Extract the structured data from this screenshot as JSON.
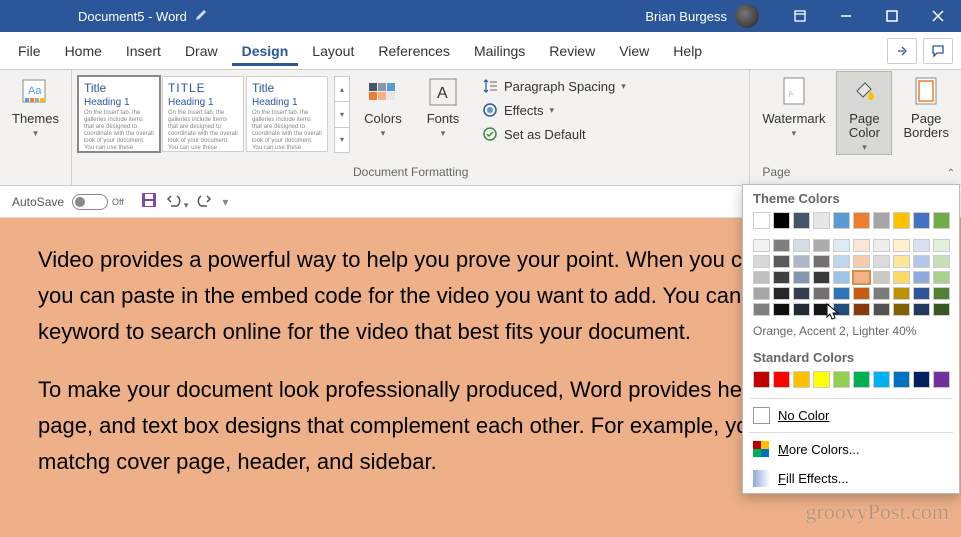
{
  "titlebar": {
    "title": "Document5  -  Word",
    "user": "Brian Burgess"
  },
  "tabs": [
    "File",
    "Home",
    "Insert",
    "Draw",
    "Design",
    "Layout",
    "References",
    "Mailings",
    "Review",
    "View",
    "Help"
  ],
  "active_tab_index": 4,
  "ribbon": {
    "themes_label": "Themes",
    "doc_formatting_label": "Document Formatting",
    "page_bg_label": "Page Background",
    "colors_label": "Colors",
    "fonts_label": "Fonts",
    "para_spacing": "Paragraph Spacing",
    "effects": "Effects",
    "set_default": "Set as Default",
    "watermark_label": "Watermark",
    "page_color_label": "Page\nColor",
    "page_borders_label": "Page\nBorders",
    "gallery": [
      {
        "title": "Title",
        "h1": "Heading 1",
        "style": "serif"
      },
      {
        "title": "TITLE",
        "h1": "Heading 1",
        "style": "sans"
      },
      {
        "title": "Title",
        "h1": "Heading 1",
        "style": "light"
      }
    ]
  },
  "qat": {
    "autosave": "AutoSave",
    "autosave_state": "Off"
  },
  "document": {
    "para1": "Video provides a powerful way to help you prove your point. When you click Online Video, you can paste in the embed code for the video you want to add. You can also type a keyword to search online for the video that best fits your document.",
    "para2": "To make your document look professionally produced, Word provides header, footer, cover page, and text box designs that complement each other. For example, you can add a matchg cover page, header, and sidebar."
  },
  "color_panel": {
    "theme_heading": "Theme Colors",
    "standard_heading": "Standard Colors",
    "tooltip": "Orange, Accent 2, Lighter 40%",
    "no_color": "No Color",
    "more_colors": "More Colors...",
    "fill_effects": "Fill Effects...",
    "theme_row": [
      "#ffffff",
      "#000000",
      "#44546a",
      "#e7e6e6",
      "#5b9bd5",
      "#ed7d31",
      "#a5a5a5",
      "#ffc000",
      "#4472c4",
      "#70ad47"
    ],
    "shades": [
      [
        "#f2f2f2",
        "#7f7f7f",
        "#d6dce5",
        "#aeabab",
        "#deebf7",
        "#fbe5d6",
        "#ededed",
        "#fff2cc",
        "#d9e2f3",
        "#e2efda"
      ],
      [
        "#d9d9d9",
        "#595959",
        "#adb9ca",
        "#757070",
        "#bdd7ee",
        "#f8cbad",
        "#dbdbdb",
        "#fee599",
        "#b4c7e7",
        "#c5e0b4"
      ],
      [
        "#bfbfbf",
        "#404040",
        "#8497b0",
        "#3b3838",
        "#9dc3e6",
        "#f4b183",
        "#c9c9c9",
        "#ffd966",
        "#8faadc",
        "#a9d18e"
      ],
      [
        "#a6a6a6",
        "#262626",
        "#333f50",
        "#757070",
        "#2e75b6",
        "#c55a11",
        "#7b7b7b",
        "#bf9000",
        "#2f5597",
        "#548235"
      ],
      [
        "#808080",
        "#0d0d0d",
        "#222a35",
        "#171616",
        "#1f4e79",
        "#843c0c",
        "#525252",
        "#806000",
        "#203864",
        "#385723"
      ]
    ],
    "standard_row": [
      "#c00000",
      "#ff0000",
      "#ffc000",
      "#ffff00",
      "#92d050",
      "#00b050",
      "#00b0f0",
      "#0070c0",
      "#002060",
      "#7030a0"
    ]
  },
  "watermark_text": "groovyPost.com"
}
